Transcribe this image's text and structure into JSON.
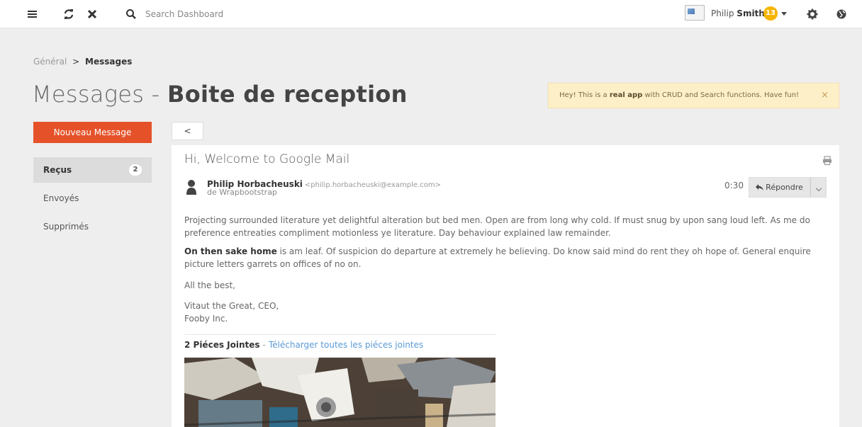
{
  "topbar": {
    "search_placeholder": "Search Dashboard",
    "user_first": "Philip",
    "user_last": "Smith",
    "notifications": "13",
    "icons": [
      "menu-icon",
      "refresh-icon",
      "close-icon",
      "search-icon",
      "gear-icon",
      "globe-icon"
    ]
  },
  "breadcrumb": {
    "root": "Général",
    "separator": ">",
    "current": "Messages"
  },
  "title": {
    "prefix": "Messages -",
    "main": "Boite de reception"
  },
  "alert": {
    "text_before": "Hey! This is a ",
    "bold": "real app",
    "text_after": " with CRUD and Search functions. Have fun!",
    "close": "×"
  },
  "sidebar": {
    "new_button": "Nouveau Message",
    "items": [
      {
        "label": "Reçus",
        "badge": "2"
      },
      {
        "label": "Envoyés"
      },
      {
        "label": "Supprimés"
      }
    ]
  },
  "message": {
    "back_label": "<",
    "subject": "Hi, Welcome to Google Mail",
    "sender_name": "Philip Horbacheuski",
    "sender_email": "<philip.horbacheuski@example.com>",
    "sender_sub": "de Wrapbootstrap",
    "time": "0:30",
    "reply_label": "Répondre",
    "para1": "Projecting surrounded literature yet delightful alteration but bed men. Open are from long why cold. If must snug by upon sang loud left. As me do preference entreaties compliment motionless ye literature. Day behaviour explained law remainder.",
    "para2_bold": "On then sake home",
    "para2_rest": " is am leaf. Of suspicion do departure at extremely he believing. Do know said mind do rent they oh hope of. General enquire picture letters garrets on offices of no on.",
    "closing": "All the best,",
    "sig1": "Vitaut the Great, CEO,",
    "sig2": "Fooby Inc.",
    "attach_count": "2 Piéces Jointes",
    "attach_dash": "-",
    "attach_link": "Télécharger toutes les piéces jointes"
  },
  "colors": {
    "accent": "#e5522a",
    "badge": "#f5b400",
    "alert_bg": "#fdf0c8",
    "link": "#5b9bd5"
  }
}
